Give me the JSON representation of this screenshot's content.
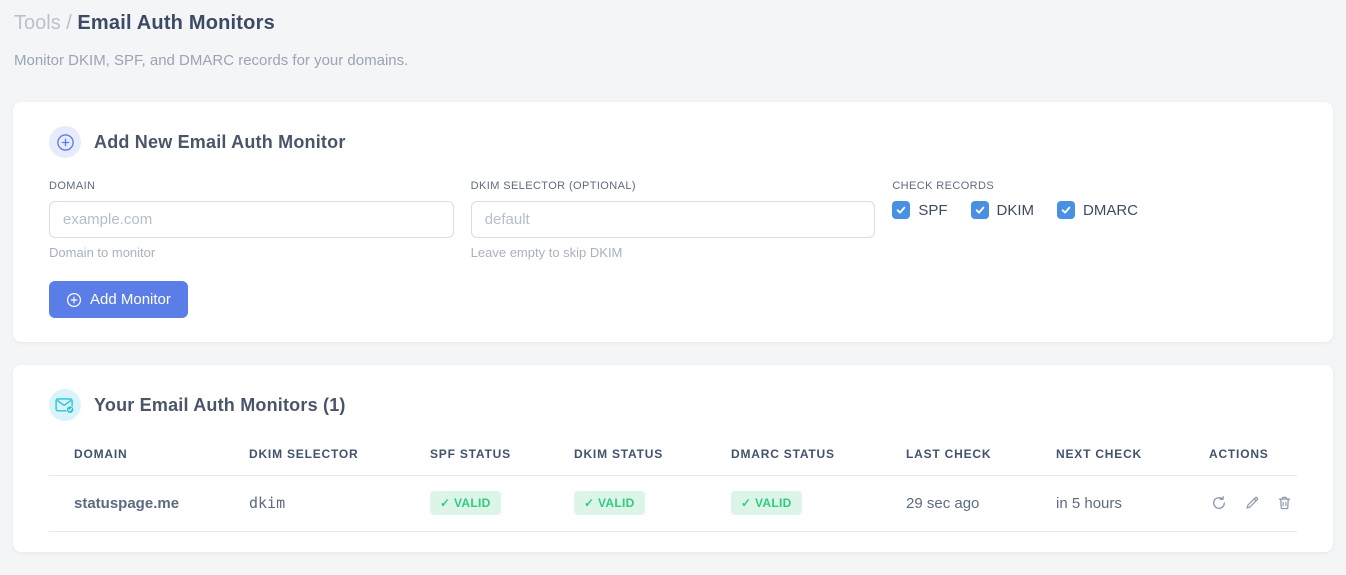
{
  "breadcrumb": {
    "section": "Tools",
    "separator": "/",
    "title": "Email Auth Monitors"
  },
  "subtitle": "Monitor DKIM, SPF, and DMARC records for your domains.",
  "add_card": {
    "title": "Add New Email Auth Monitor",
    "fields": {
      "domain": {
        "label": "DOMAIN",
        "placeholder": "example.com",
        "helper": "Domain to monitor",
        "value": ""
      },
      "dkim_selector": {
        "label": "DKIM SELECTOR (OPTIONAL)",
        "placeholder": "default",
        "helper": "Leave empty to skip DKIM",
        "value": ""
      }
    },
    "check_records": {
      "label": "CHECK RECORDS",
      "options": [
        {
          "label": "SPF",
          "checked": true
        },
        {
          "label": "DKIM",
          "checked": true
        },
        {
          "label": "DMARC",
          "checked": true
        }
      ]
    },
    "submit_label": "Add Monitor"
  },
  "monitors_card": {
    "title": "Your Email Auth Monitors (1)",
    "count": 1,
    "table": {
      "headers": [
        "DOMAIN",
        "DKIM SELECTOR",
        "SPF STATUS",
        "DKIM STATUS",
        "DMARC STATUS",
        "LAST CHECK",
        "NEXT CHECK",
        "ACTIONS"
      ],
      "rows": [
        {
          "domain": "statuspage.me",
          "dkim_selector": "dkim",
          "spf_status": "✓ VALID",
          "dkim_status": "✓ VALID",
          "dmarc_status": "✓ VALID",
          "last_check": "29 sec ago",
          "next_check": "in 5 hours"
        }
      ]
    }
  },
  "colors": {
    "accent_blue": "#5b7de8",
    "checkbox_blue": "#4a90e2",
    "accent_cyan": "#29c3da",
    "valid_green": "#2ecc81",
    "valid_green_bg": "#dcf5e8",
    "code_pink": "#e8467c",
    "page_bg": "#f4f5f7"
  }
}
